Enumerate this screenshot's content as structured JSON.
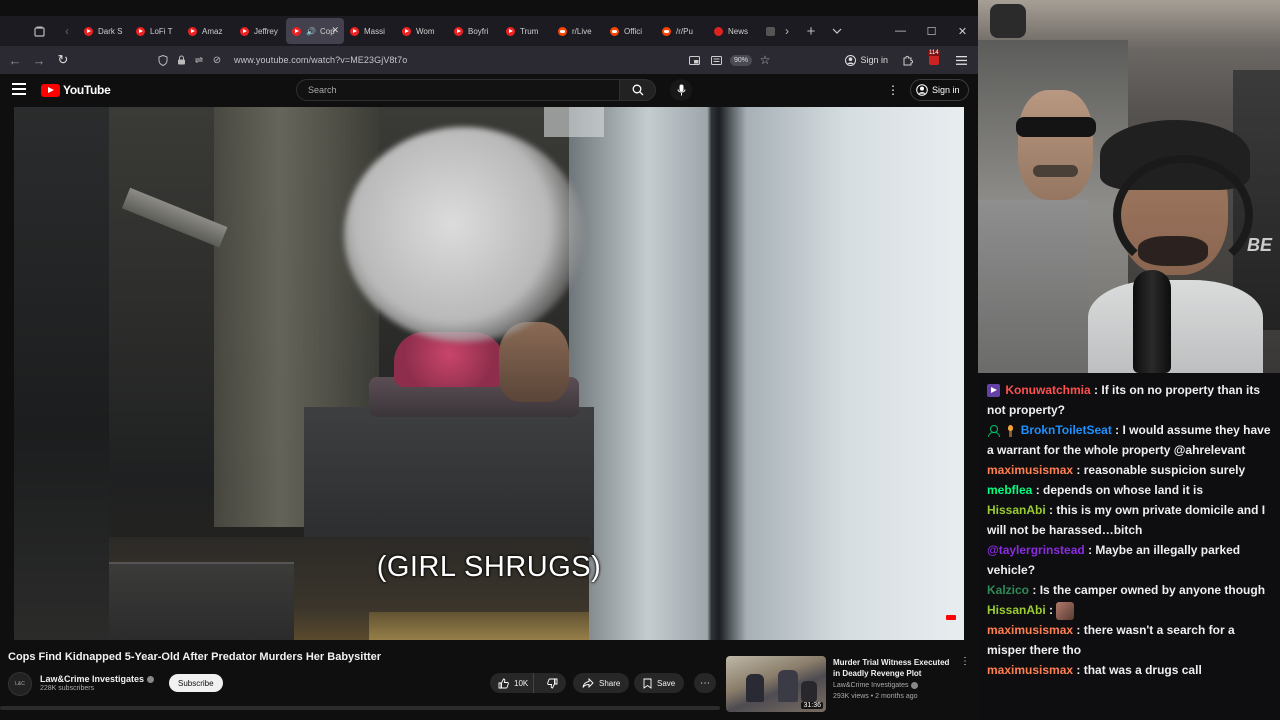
{
  "browser": {
    "tabs": [
      {
        "title": "Dark S",
        "favicon": "youtube-icon",
        "active": false
      },
      {
        "title": "LoFi T",
        "favicon": "youtube-icon",
        "active": false
      },
      {
        "title": "Amaz",
        "favicon": "youtube-icon",
        "active": false
      },
      {
        "title": "Jeffrey",
        "favicon": "youtube-icon",
        "active": false
      },
      {
        "title": "Cop",
        "favicon": "youtube-icon",
        "active": true,
        "audio": true
      },
      {
        "title": "Massi",
        "favicon": "youtube-icon",
        "active": false
      },
      {
        "title": "Wom",
        "favicon": "youtube-icon",
        "active": false
      },
      {
        "title": "Boyfri",
        "favicon": "youtube-icon",
        "active": false
      },
      {
        "title": "Trum",
        "favicon": "youtube-icon",
        "active": false
      },
      {
        "title": "r/Live",
        "favicon": "reddit-icon",
        "active": false
      },
      {
        "title": "Offici",
        "favicon": "reddit-icon",
        "active": false
      },
      {
        "title": "/r/Pu",
        "favicon": "reddit-icon",
        "active": false
      },
      {
        "title": "News",
        "favicon": "news-icon",
        "active": false
      }
    ],
    "url": "www.youtube.com/watch?v=ME23GjV8t7o",
    "zoom": "90%",
    "signin_label": "Sign in",
    "extension_count": "114"
  },
  "youtube": {
    "logo_text": "YouTube",
    "search_placeholder": "Search",
    "signin_label": "Sign in",
    "video": {
      "caption": "(GIRL SHRUGS)",
      "title": "Cops Find Kidnapped 5-Year-Old After Predator Murders Her Babysitter",
      "channel": "Law&Crime Investigates",
      "subscribers": "228K subscribers",
      "subscribe_label": "Subscribe",
      "likes": "10K",
      "share_label": "Share",
      "save_label": "Save"
    },
    "recommended": {
      "title": "Murder Trial Witness Executed in Deadly Revenge Plot",
      "channel": "Law&Crime Investigates",
      "meta": "293K views • 2 months ago",
      "duration": "31:36"
    }
  },
  "chat": {
    "messages": [
      {
        "badges": [
          "sub-badge"
        ],
        "user": "Konuwatchmia",
        "color": "#ff4f4f",
        "text": "If its on no property than its not property?"
      },
      {
        "badges": [
          "person-badge",
          "torch-badge"
        ],
        "user": "BroknToiletSeat",
        "color": "#1e90ff",
        "text": "I would assume they have a warrant for the whole property @ahrelevant"
      },
      {
        "badges": [],
        "user": "maximusismax",
        "color": "#ff7f50",
        "text": "reasonable suspicion surely"
      },
      {
        "badges": [],
        "user": "mebflea",
        "color": "#00ff7f",
        "text": "depends on whose land it is"
      },
      {
        "badges": [],
        "user": "HissanAbi",
        "color": "#9acd32",
        "text": "this is my own private domicile and I will not be harassed…bitch"
      },
      {
        "badges": [],
        "user": "@taylergrinstead",
        "color": "#8a2be2",
        "text": "Maybe an illegally parked vehicle?"
      },
      {
        "badges": [],
        "user": "Kalzico",
        "color": "#2e8b57",
        "text": "Is the camper owned by anyone though"
      },
      {
        "badges": [],
        "user": "HissanAbi",
        "color": "#9acd32",
        "text": "",
        "emote": "chat-emote"
      },
      {
        "badges": [],
        "user": "maximusismax",
        "color": "#ff7f50",
        "text": "there wasn't a search for a misper there tho"
      },
      {
        "badges": [],
        "user": "maximusismax",
        "color": "#ff7f50",
        "text": "that was a drugs call"
      }
    ]
  },
  "colors": {
    "youtube_red": "#ff0000",
    "chat_bg": "#0e0e10",
    "browser_tabbar": "#1c1b22",
    "browser_navbar": "#2b2a33"
  }
}
